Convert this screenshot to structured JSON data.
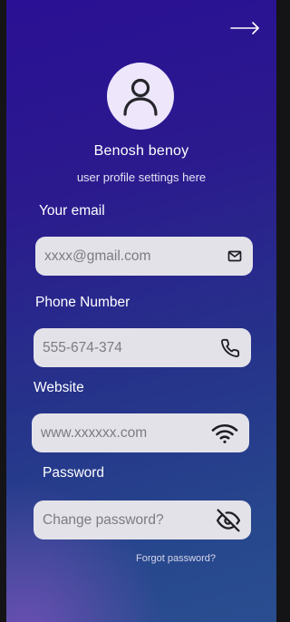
{
  "profile": {
    "name": "Benosh benoy",
    "subtitle": "user profile settings here"
  },
  "icons": {
    "next": "arrow-right-icon",
    "avatar": "user-icon",
    "email": "mail-icon",
    "phone": "phone-icon",
    "website": "wifi-icon",
    "password": "eye-off-icon"
  },
  "form": {
    "email": {
      "label": "Your email",
      "placeholder": "xxxx@gmail.com"
    },
    "phone": {
      "label": "Phone Number",
      "placeholder": "555-674-374"
    },
    "website": {
      "label": "Website",
      "placeholder": "www.xxxxxx.com"
    },
    "password": {
      "label": "Password",
      "placeholder": "Change password?"
    },
    "forgot_link": "Forgot password?"
  },
  "colors": {
    "panel_top": "#2a1094",
    "panel_bottom": "#2a4d90",
    "field_bg": "#e3e2e9",
    "avatar_bg": "#eee6fb"
  }
}
